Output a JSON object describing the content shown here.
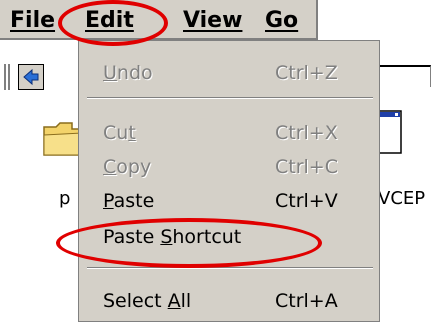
{
  "menubar": {
    "items": [
      {
        "label": "File",
        "accel_index": 0
      },
      {
        "label": "Edit",
        "accel_index": 0
      },
      {
        "label": "View",
        "accel_index": 0
      },
      {
        "label": "Go",
        "accel_index": 0
      }
    ]
  },
  "toolbar": {
    "back_icon": "back-arrow-icon"
  },
  "desktop": {
    "left_label": "p",
    "right_label": "VCEP"
  },
  "edit_menu": {
    "items": [
      {
        "pre": "",
        "accel": "U",
        "post": "ndo",
        "shortcut": "Ctrl+Z",
        "enabled": false
      },
      {
        "pre": "Cu",
        "accel": "t",
        "post": "",
        "shortcut": "Ctrl+X",
        "enabled": false
      },
      {
        "pre": "",
        "accel": "C",
        "post": "opy",
        "shortcut": "Ctrl+C",
        "enabled": false
      },
      {
        "pre": "",
        "accel": "P",
        "post": "aste",
        "shortcut": "Ctrl+V",
        "enabled": true
      },
      {
        "pre": "Paste ",
        "accel": "S",
        "post": "hortcut",
        "shortcut": "",
        "enabled": true
      },
      {
        "pre": "Select ",
        "accel": "A",
        "post": "ll",
        "shortcut": "Ctrl+A",
        "enabled": true
      }
    ]
  },
  "colors": {
    "annotation": "#e00000",
    "menu_bg": "#d4d0c8",
    "disabled_text": "#808080"
  }
}
